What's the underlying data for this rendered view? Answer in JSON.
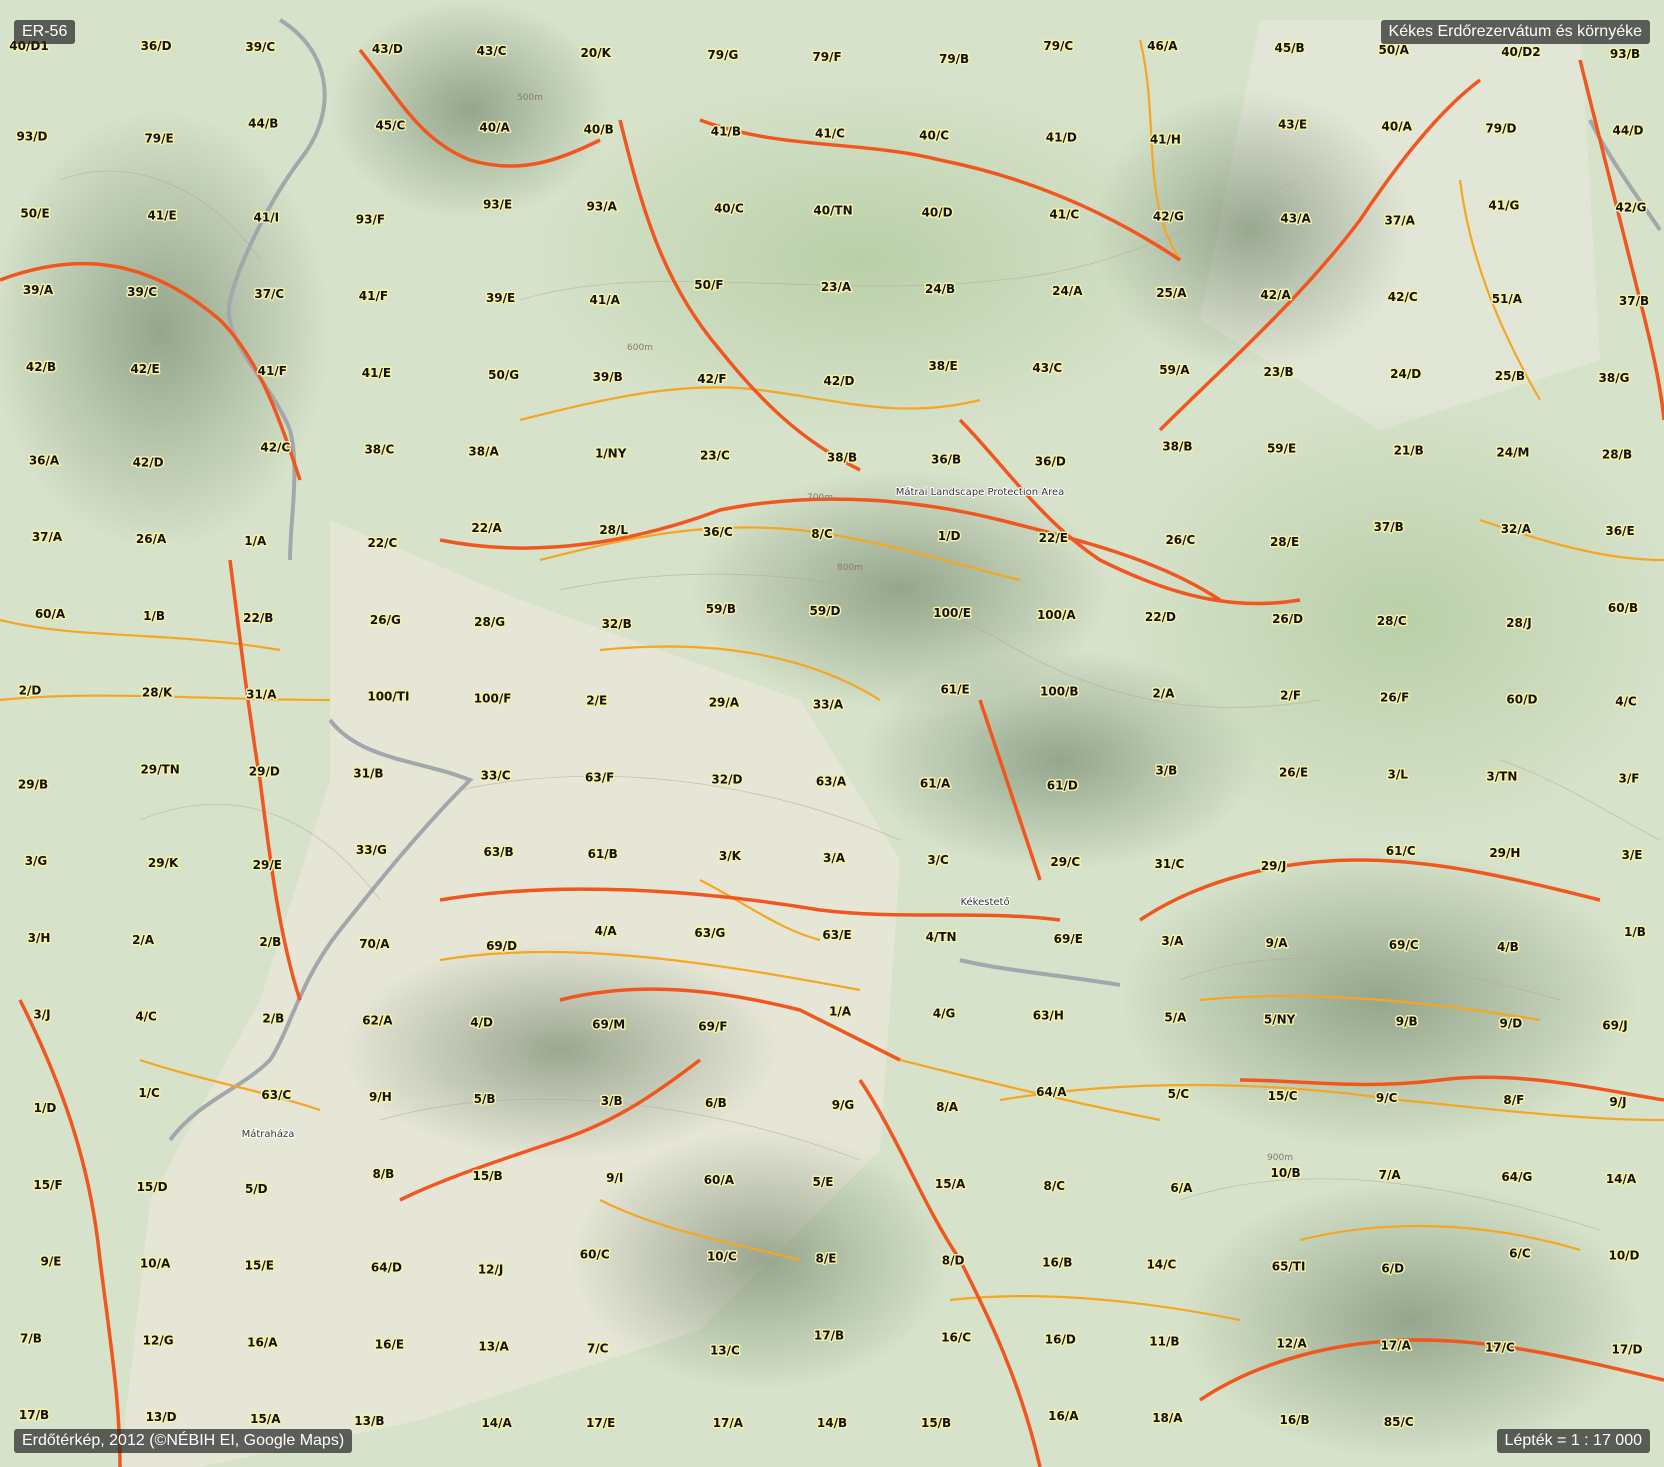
{
  "map": {
    "id_badge": "ER-56",
    "title": "Kékes Erdőrezervátum és környéke",
    "attribution": "Erdőtérkép, 2012 (©NÉBIH EI, Google Maps)",
    "scale": "Lépték = 1 : 17 000",
    "colors": {
      "terrain_light": "#e3e7d6",
      "forest": "#c4d6b4",
      "shade": "#6f8466",
      "major_boundary": "#f1561e",
      "minor_boundary": "#f5a623",
      "road": "#9aa0a6",
      "label_halo": "#f5f1a8"
    },
    "place_labels": [
      "Mátrai Landscape Protection Area",
      "Kékestető",
      "Mátraháza"
    ],
    "contour_labels": [
      "500m",
      "600m",
      "700m",
      "800m",
      "900m"
    ],
    "parcel_labels": [
      "40/D1",
      "36/D",
      "39/C",
      "43/D",
      "43/C",
      "20/K",
      "79/G",
      "79/F",
      "79/B",
      "79/C",
      "46/A",
      "45/B",
      "50/A",
      "40/D2",
      "93/B",
      "93/D",
      "79/E",
      "44/B",
      "45/C",
      "40/A",
      "40/B",
      "41/B",
      "41/C",
      "40/C",
      "41/D",
      "41/H",
      "43/E",
      "40/A",
      "79/D",
      "44/D",
      "50/E",
      "41/E",
      "41/I",
      "93/F",
      "93/E",
      "93/A",
      "40/C",
      "40/TN",
      "40/D",
      "41/C",
      "42/G",
      "43/A",
      "37/A",
      "41/G",
      "42/G",
      "39/A",
      "39/C",
      "37/C",
      "41/F",
      "39/E",
      "41/A",
      "50/F",
      "23/A",
      "24/B",
      "24/A",
      "25/A",
      "42/A",
      "42/C",
      "51/A",
      "37/B",
      "42/B",
      "42/E",
      "41/F",
      "41/E",
      "50/G",
      "39/B",
      "42/F",
      "42/D",
      "38/E",
      "43/C",
      "59/A",
      "23/B",
      "24/D",
      "25/B",
      "38/G",
      "36/A",
      "42/D",
      "42/C",
      "38/C",
      "38/A",
      "1/NY",
      "23/C",
      "38/B",
      "36/B",
      "36/D",
      "38/B",
      "59/E",
      "21/B",
      "24/M",
      "28/B",
      "37/A",
      "26/A",
      "1/A",
      "22/C",
      "22/A",
      "28/L",
      "36/C",
      "8/C",
      "1/D",
      "22/E",
      "26/C",
      "28/E",
      "37/B",
      "32/A",
      "36/E",
      "60/A",
      "1/B",
      "22/B",
      "26/G",
      "28/G",
      "32/B",
      "59/B",
      "59/D",
      "100/E",
      "100/A",
      "22/D",
      "26/D",
      "28/C",
      "28/J",
      "60/B",
      "2/D",
      "28/K",
      "31/A",
      "100/TI",
      "100/F",
      "2/E",
      "29/A",
      "33/A",
      "61/E",
      "100/B",
      "2/A",
      "2/F",
      "26/F",
      "60/D",
      "4/C",
      "29/B",
      "29/TN",
      "29/D",
      "31/B",
      "33/C",
      "63/F",
      "32/D",
      "63/A",
      "61/A",
      "61/D",
      "3/B",
      "26/E",
      "3/L",
      "3/TN",
      "3/F",
      "3/G",
      "29/K",
      "29/E",
      "33/G",
      "63/B",
      "61/B",
      "3/K",
      "3/A",
      "3/C",
      "29/C",
      "31/C",
      "29/J",
      "61/C",
      "29/H",
      "3/E",
      "3/H",
      "2/A",
      "2/B",
      "70/A",
      "69/D",
      "4/A",
      "63/G",
      "63/E",
      "4/TN",
      "69/E",
      "3/A",
      "9/A",
      "69/C",
      "4/B",
      "1/B",
      "3/J",
      "4/C",
      "2/B",
      "62/A",
      "4/D",
      "69/M",
      "69/F",
      "1/A",
      "4/G",
      "63/H",
      "5/A",
      "5/NY",
      "9/B",
      "9/D",
      "69/J",
      "1/D",
      "1/C",
      "63/C",
      "9/H",
      "5/B",
      "3/B",
      "6/B",
      "9/G",
      "8/A",
      "64/A",
      "5/C",
      "15/C",
      "9/C",
      "8/F",
      "9/J",
      "15/F",
      "15/D",
      "5/D",
      "8/B",
      "15/B",
      "9/I",
      "60/A",
      "5/E",
      "15/A",
      "8/C",
      "6/A",
      "10/B",
      "7/A",
      "64/G",
      "14/A",
      "9/E",
      "10/A",
      "15/E",
      "64/D",
      "12/J",
      "60/C",
      "10/C",
      "8/E",
      "8/D",
      "16/B",
      "14/C",
      "65/TI",
      "6/D",
      "6/C",
      "10/D",
      "7/B",
      "12/G",
      "16/A",
      "16/E",
      "13/A",
      "7/C",
      "13/C",
      "17/B",
      "16/C",
      "16/D",
      "11/B",
      "12/A",
      "17/A",
      "17/C",
      "17/D",
      "17/B",
      "13/D",
      "15/A",
      "13/B",
      "14/A",
      "17/E",
      "17/A",
      "14/B",
      "15/B",
      "16/A",
      "18/A",
      "16/B",
      "85/C"
    ]
  }
}
